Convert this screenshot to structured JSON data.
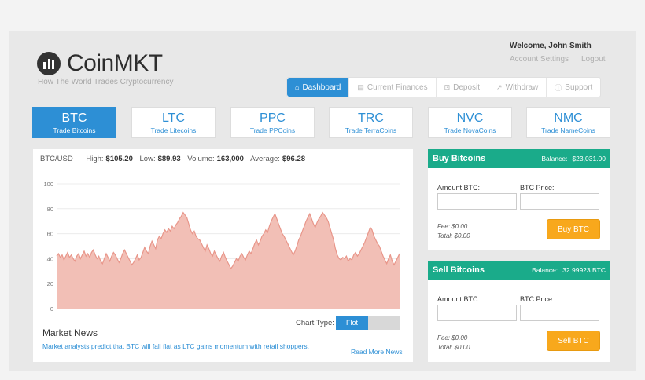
{
  "brand": {
    "name": "CoinMKT",
    "tagline": "How The World Trades Cryptocurrency"
  },
  "account": {
    "welcome": "Welcome, John Smith",
    "settings": "Account Settings",
    "logout": "Logout"
  },
  "nav": [
    {
      "icon": "home-icon",
      "glyph": "⌂",
      "label": "Dashboard",
      "active": true
    },
    {
      "icon": "finances-icon",
      "glyph": "▤",
      "label": "Current Finances"
    },
    {
      "icon": "deposit-icon",
      "glyph": "⊡",
      "label": "Deposit"
    },
    {
      "icon": "withdraw-icon",
      "glyph": "↗",
      "label": "Withdraw"
    },
    {
      "icon": "support-icon",
      "glyph": "ⓘ",
      "label": "Support"
    }
  ],
  "coins": [
    {
      "symbol": "BTC",
      "sub": "Trade Bitcoins",
      "active": true
    },
    {
      "symbol": "LTC",
      "sub": "Trade Litecoins"
    },
    {
      "symbol": "PPC",
      "sub": "Trade PPCoins"
    },
    {
      "symbol": "TRC",
      "sub": "Trade TerraCoins"
    },
    {
      "symbol": "NVC",
      "sub": "Trade NovaCoins"
    },
    {
      "symbol": "NMC",
      "sub": "Trade NameCoins"
    }
  ],
  "stats": {
    "pair": "BTC/USD",
    "high_label": "High:",
    "high": "$105.20",
    "low_label": "Low:",
    "low": "$89.93",
    "volume_label": "Volume:",
    "volume": "163,000",
    "average_label": "Average:",
    "average": "$96.28"
  },
  "chart_data": {
    "type": "area",
    "ylim": [
      0,
      100
    ],
    "yticks": [
      0,
      20,
      40,
      60,
      80,
      100
    ],
    "grid": true,
    "color": "#e8968a",
    "fill": "#f2bfb6",
    "values": [
      42,
      44,
      41,
      43,
      39,
      42,
      45,
      41,
      43,
      40,
      38,
      42,
      44,
      40,
      43,
      46,
      42,
      44,
      41,
      45,
      47,
      43,
      40,
      42,
      38,
      36,
      40,
      44,
      41,
      38,
      42,
      45,
      43,
      40,
      37,
      40,
      44,
      47,
      44,
      41,
      38,
      35,
      37,
      40,
      43,
      39,
      41,
      45,
      49,
      46,
      44,
      50,
      54,
      51,
      48,
      55,
      58,
      56,
      60,
      63,
      61,
      64,
      62,
      66,
      64,
      67,
      69,
      72,
      74,
      77,
      75,
      73,
      68,
      63,
      60,
      62,
      58,
      56,
      55,
      52,
      49,
      46,
      51,
      48,
      44,
      42,
      46,
      43,
      40,
      38,
      42,
      45,
      41,
      38,
      35,
      32,
      34,
      37,
      40,
      38,
      42,
      44,
      41,
      39,
      43,
      46,
      44,
      48,
      52,
      55,
      51,
      54,
      58,
      60,
      63,
      61,
      66,
      70,
      73,
      76,
      72,
      68,
      64,
      60,
      58,
      55,
      52,
      49,
      46,
      43,
      46,
      50,
      55,
      58,
      62,
      66,
      70,
      73,
      76,
      72,
      68,
      65,
      69,
      72,
      74,
      77,
      75,
      73,
      70,
      65,
      60,
      55,
      48,
      43,
      40,
      39,
      41,
      40,
      42,
      38,
      40,
      39,
      43,
      45,
      42,
      44,
      47,
      50,
      53,
      57,
      61,
      65,
      63,
      58,
      55,
      52,
      50,
      46,
      42,
      39,
      36,
      40,
      43,
      38,
      35,
      38,
      41,
      44
    ]
  },
  "chart_controls": {
    "type_label": "Chart Type:",
    "option_active": "Flot"
  },
  "news": {
    "title": "Market News",
    "text": "Market analysts predict that BTC will fall flat as LTC gains momentum with retail shoppers.",
    "read_more": "Read More News"
  },
  "buy": {
    "title": "Buy Bitcoins",
    "balance_label": "Balance:",
    "balance": "$23,031.00",
    "amount_label": "Amount BTC:",
    "price_label": "BTC Price:",
    "fee": "Fee: $0.00",
    "total": "Total: $0.00",
    "button": "Buy BTC"
  },
  "sell": {
    "title": "Sell Bitcoins",
    "balance_label": "Balance:",
    "balance": "32.99923 BTC",
    "amount_label": "Amount BTC:",
    "price_label": "BTC Price:",
    "fee": "Fee: $0.00",
    "total": "Total: $0.00",
    "button": "Sell BTC"
  }
}
